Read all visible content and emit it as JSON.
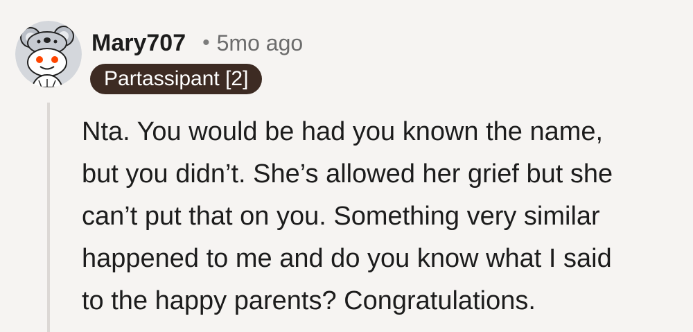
{
  "comment": {
    "author": "Mary707",
    "separator": "•",
    "time_ago": "5mo ago",
    "flair": "Partassipant [2]",
    "body": "Nta. You would be had you known the name,\nbut you didn’t. She’s allowed her grief but she\ncan’t put that on you. Something very similar\nhappened to me and do you know what I said\nto the happy parents? Congratulations.",
    "avatar_icon": "snoo-koala-avatar-icon",
    "colors": {
      "flair_bg": "#3d2b23",
      "page_bg": "#f6f4f2",
      "thread_line": "#dcd8d5",
      "avatar_bg": "#d4d7dc"
    }
  }
}
